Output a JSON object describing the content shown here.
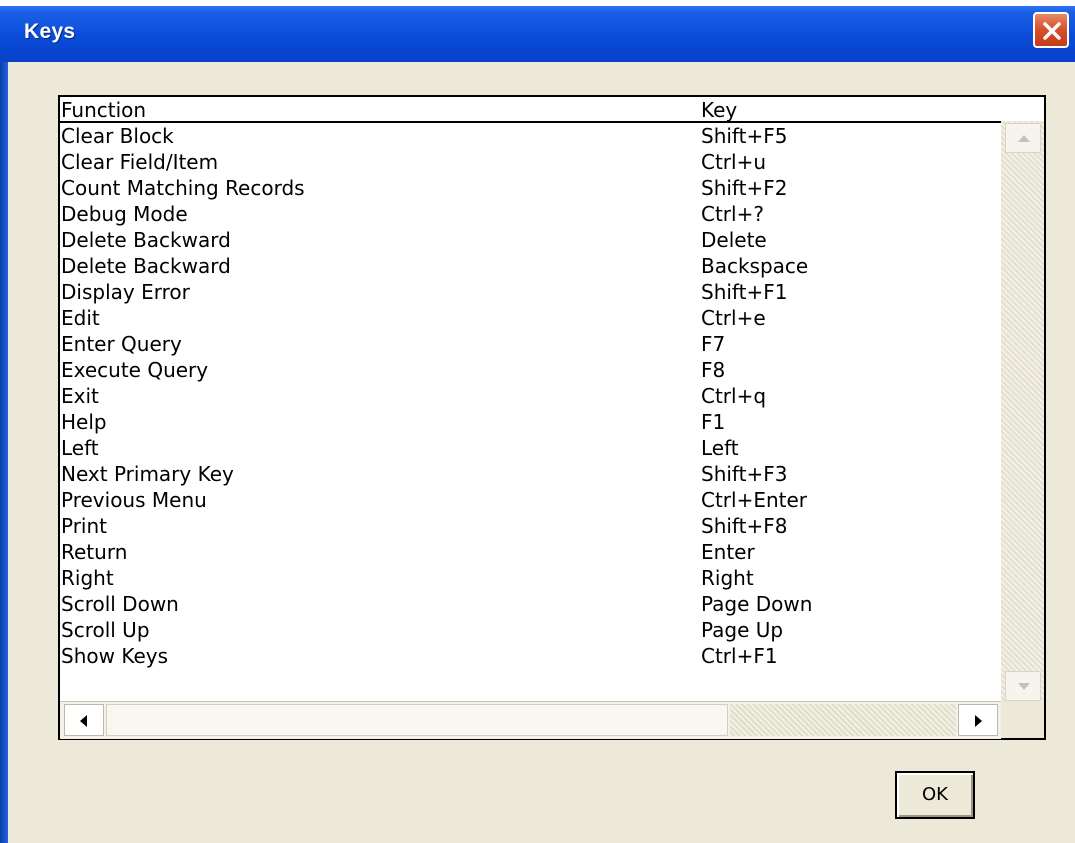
{
  "window": {
    "title": "Keys",
    "close_icon": "close-icon"
  },
  "list": {
    "columns": [
      "Function",
      "Key"
    ],
    "rows": [
      {
        "function": "Clear Block",
        "key": "Shift+F5"
      },
      {
        "function": "Clear Field/Item",
        "key": "Ctrl+u"
      },
      {
        "function": "Count Matching Records",
        "key": "Shift+F2"
      },
      {
        "function": "Debug Mode",
        "key": "Ctrl+?"
      },
      {
        "function": "Delete Backward",
        "key": "Delete"
      },
      {
        "function": "Delete Backward",
        "key": "Backspace"
      },
      {
        "function": "Display Error",
        "key": "Shift+F1"
      },
      {
        "function": "Edit",
        "key": "Ctrl+e"
      },
      {
        "function": "Enter Query",
        "key": "F7"
      },
      {
        "function": "Execute Query",
        "key": "F8"
      },
      {
        "function": "Exit",
        "key": "Ctrl+q"
      },
      {
        "function": "Help",
        "key": "F1"
      },
      {
        "function": "Left",
        "key": "Left"
      },
      {
        "function": "Next Primary Key",
        "key": "Shift+F3"
      },
      {
        "function": "Previous Menu",
        "key": "Ctrl+Enter"
      },
      {
        "function": "Print",
        "key": "Shift+F8"
      },
      {
        "function": "Return",
        "key": "Enter"
      },
      {
        "function": "Right",
        "key": "Right"
      },
      {
        "function": "Scroll Down",
        "key": "Page Down"
      },
      {
        "function": "Scroll Up",
        "key": "Page Up"
      },
      {
        "function": "Show Keys",
        "key": "Ctrl+F1"
      }
    ]
  },
  "buttons": {
    "ok_label": "OK"
  },
  "colors": {
    "titlebar": "#0a4cd8",
    "dialog_bg": "#ece9d8",
    "close_button": "#d8522e"
  }
}
